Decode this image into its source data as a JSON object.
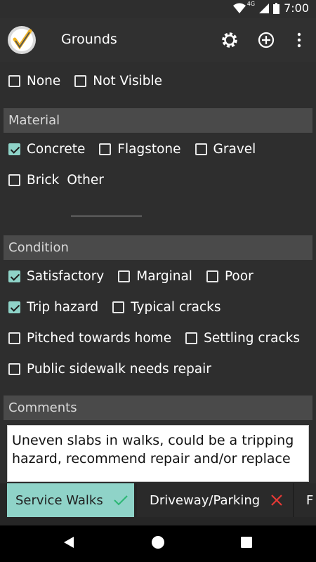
{
  "status": {
    "network": "4G",
    "time": "7:00"
  },
  "appbar": {
    "title": "Grounds"
  },
  "visibility": {
    "options": [
      {
        "label": "None",
        "checked": false
      },
      {
        "label": "Not Visible",
        "checked": false
      }
    ]
  },
  "material": {
    "header": "Material",
    "row1": [
      {
        "label": "Concrete",
        "checked": true
      },
      {
        "label": "Flagstone",
        "checked": false
      },
      {
        "label": "Gravel",
        "checked": false
      }
    ],
    "brick": {
      "label": "Brick",
      "checked": false
    },
    "other_label": "Other",
    "other_value": ""
  },
  "condition": {
    "header": "Condition",
    "row1": [
      {
        "label": "Satisfactory",
        "checked": true
      },
      {
        "label": "Marginal",
        "checked": false
      },
      {
        "label": "Poor",
        "checked": false
      }
    ],
    "row2": [
      {
        "label": "Trip hazard",
        "checked": true
      },
      {
        "label": "Typical cracks",
        "checked": false
      }
    ],
    "row3": [
      {
        "label": "Pitched towards home",
        "checked": false
      },
      {
        "label": "Settling cracks",
        "checked": false
      }
    ],
    "row4": [
      {
        "label": "Public sidewalk needs repair",
        "checked": false
      }
    ]
  },
  "comments": {
    "header": "Comments",
    "text": "Uneven slabs in walks, could be a tripping hazard, recommend repair and/or replace"
  },
  "tabs": [
    {
      "label": "Service Walks",
      "status": "complete"
    },
    {
      "label": "Driveway/Parking",
      "status": "incomplete"
    },
    {
      "label": "F",
      "status": ""
    }
  ],
  "colors": {
    "accent": "#8fd3c8",
    "error": "#e53935",
    "background": "#2f2f2f",
    "section": "#4a4a4a"
  }
}
